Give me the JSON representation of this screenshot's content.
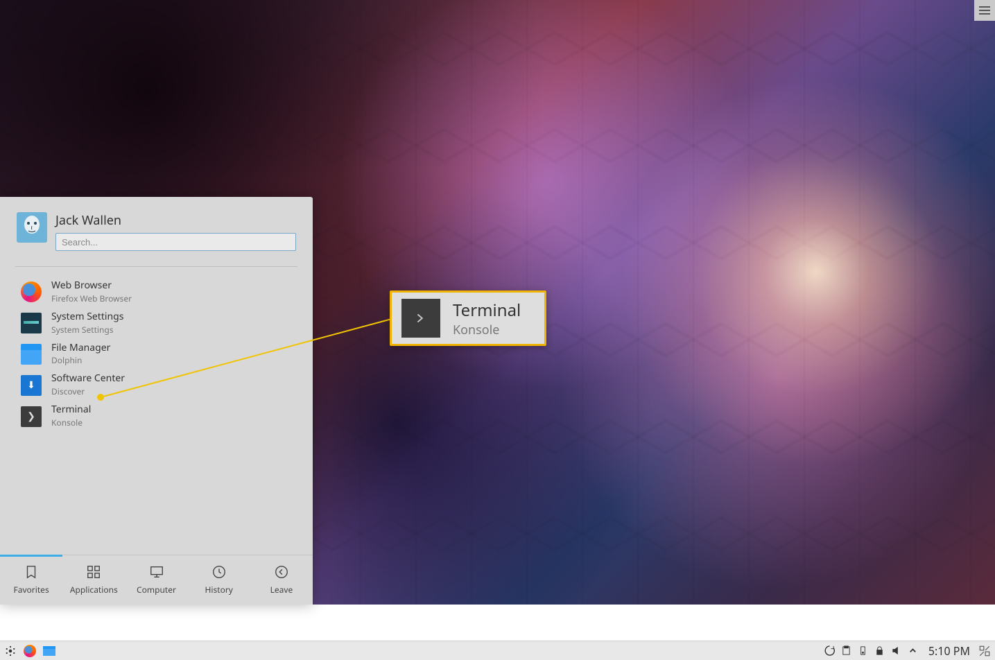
{
  "user": {
    "name": "Jack Wallen"
  },
  "search": {
    "placeholder": "Search..."
  },
  "favorites": [
    {
      "title": "Web Browser",
      "subtitle": "Firefox Web Browser",
      "icon": "firefox"
    },
    {
      "title": "System Settings",
      "subtitle": "System Settings",
      "icon": "settings"
    },
    {
      "title": "File Manager",
      "subtitle": "Dolphin",
      "icon": "files"
    },
    {
      "title": "Software Center",
      "subtitle": "Discover",
      "icon": "software"
    },
    {
      "title": "Terminal",
      "subtitle": "Konsole",
      "icon": "terminal"
    }
  ],
  "tabs": {
    "favorites": "Favorites",
    "applications": "Applications",
    "computer": "Computer",
    "history": "History",
    "leave": "Leave"
  },
  "callout": {
    "title": "Terminal",
    "subtitle": "Konsole"
  },
  "clock": "5:10 PM"
}
